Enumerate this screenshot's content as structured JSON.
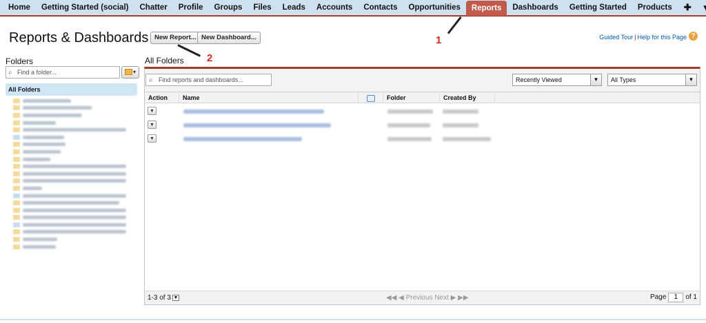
{
  "tabs": [
    {
      "label": "Home"
    },
    {
      "label": "Getting Started (social)"
    },
    {
      "label": "Chatter"
    },
    {
      "label": "Profile"
    },
    {
      "label": "Groups"
    },
    {
      "label": "Files"
    },
    {
      "label": "Leads"
    },
    {
      "label": "Accounts"
    },
    {
      "label": "Contacts"
    },
    {
      "label": "Opportunities"
    },
    {
      "label": "Reports"
    },
    {
      "label": "Dashboards"
    },
    {
      "label": "Getting Started"
    },
    {
      "label": "Products"
    }
  ],
  "tab_more_icon": "plus-icon",
  "tab_menu_icon": "caret-down-icon",
  "header": {
    "title": "Reports & Dashboards",
    "new_report_label": "New Report...",
    "new_dashboard_label": "New Dashboard...",
    "guided_tour": "Guided Tour",
    "separator": "|",
    "help": "Help for this Page"
  },
  "annotations": {
    "one": "1",
    "two": "2"
  },
  "folders": {
    "title": "Folders",
    "search_placeholder": "Find a folder...",
    "all_folders": "All Folders"
  },
  "main": {
    "title": "All Folders",
    "search_placeholder": "Find reports and dashboards...",
    "sort_select": "Recently Viewed",
    "type_select": "All Types",
    "columns": {
      "action": "Action",
      "name": "Name",
      "folder": "Folder",
      "created_by": "Created By"
    },
    "row_count": 3,
    "footer": {
      "count": "1-3 of 3",
      "prev": "◀◀ ◀ Previous",
      "next": "Next ▶ ▶▶",
      "page_label": "Page",
      "page_value": "1",
      "page_total": "of 1"
    }
  },
  "colors": {
    "accent": "#a33b2d",
    "active_tab": "#c25a4b",
    "tabbar": "#cfe0ee",
    "link": "#015ba7",
    "annotation": "#d32a1c"
  }
}
